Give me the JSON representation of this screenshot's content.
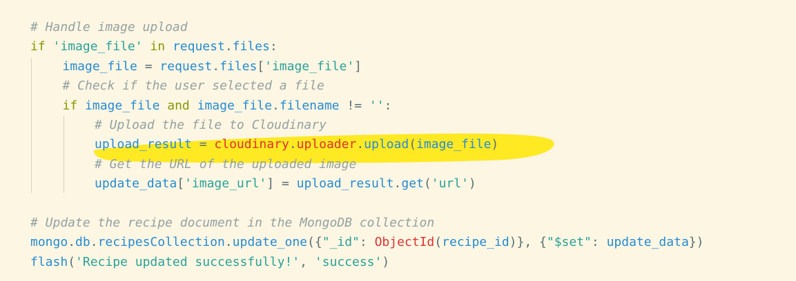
{
  "colors": {
    "background": "#fdf6e3",
    "comment": "#93a1a1",
    "keyword": "#859900",
    "string": "#2aa198",
    "name": "#268bd2",
    "call": "#dc322f",
    "punct": "#586e75",
    "highlight": "#ffe600"
  },
  "lines": [
    {
      "indent": 0,
      "tokens": [
        {
          "t": "# Handle image upload",
          "c": "comment"
        }
      ]
    },
    {
      "indent": 0,
      "tokens": [
        {
          "t": "if",
          "c": "keyword"
        },
        {
          "t": " ",
          "c": "punct"
        },
        {
          "t": "'image_file'",
          "c": "string"
        },
        {
          "t": " ",
          "c": "punct"
        },
        {
          "t": "in",
          "c": "keyword"
        },
        {
          "t": " ",
          "c": "punct"
        },
        {
          "t": "request",
          "c": "name"
        },
        {
          "t": ".",
          "c": "punct"
        },
        {
          "t": "files",
          "c": "name"
        },
        {
          "t": ":",
          "c": "punct"
        }
      ]
    },
    {
      "indent": 1,
      "tokens": [
        {
          "t": "image_file",
          "c": "name"
        },
        {
          "t": " = ",
          "c": "punct"
        },
        {
          "t": "request",
          "c": "name"
        },
        {
          "t": ".",
          "c": "punct"
        },
        {
          "t": "files",
          "c": "name"
        },
        {
          "t": "[",
          "c": "punct"
        },
        {
          "t": "'image_file'",
          "c": "string"
        },
        {
          "t": "]",
          "c": "punct"
        }
      ]
    },
    {
      "indent": 1,
      "tokens": [
        {
          "t": "# Check if the user selected a file",
          "c": "comment"
        }
      ]
    },
    {
      "indent": 1,
      "tokens": [
        {
          "t": "if",
          "c": "keyword"
        },
        {
          "t": " ",
          "c": "punct"
        },
        {
          "t": "image_file",
          "c": "name"
        },
        {
          "t": " ",
          "c": "punct"
        },
        {
          "t": "and",
          "c": "keyword"
        },
        {
          "t": " ",
          "c": "punct"
        },
        {
          "t": "image_file",
          "c": "name"
        },
        {
          "t": ".",
          "c": "punct"
        },
        {
          "t": "filename",
          "c": "name"
        },
        {
          "t": " != ",
          "c": "punct"
        },
        {
          "t": "''",
          "c": "string"
        },
        {
          "t": ":",
          "c": "punct"
        }
      ]
    },
    {
      "indent": 2,
      "tokens": [
        {
          "t": "# Upload the file to Cloudinary",
          "c": "comment"
        }
      ]
    },
    {
      "indent": 2,
      "tokens": [
        {
          "t": "upload_result",
          "c": "name"
        },
        {
          "t": " = ",
          "c": "punct"
        },
        {
          "t": "cloudinary",
          "c": "call"
        },
        {
          "t": ".",
          "c": "punct"
        },
        {
          "t": "uploader",
          "c": "call"
        },
        {
          "t": ".",
          "c": "punct"
        },
        {
          "t": "upload",
          "c": "name"
        },
        {
          "t": "(",
          "c": "punct"
        },
        {
          "t": "image_file",
          "c": "name"
        },
        {
          "t": ")",
          "c": "punct"
        }
      ]
    },
    {
      "indent": 2,
      "tokens": [
        {
          "t": "# Get the URL of the uploaded image",
          "c": "comment"
        }
      ]
    },
    {
      "indent": 2,
      "tokens": [
        {
          "t": "update_data",
          "c": "name"
        },
        {
          "t": "[",
          "c": "punct"
        },
        {
          "t": "'image_url'",
          "c": "string"
        },
        {
          "t": "] = ",
          "c": "punct"
        },
        {
          "t": "upload_result",
          "c": "name"
        },
        {
          "t": ".",
          "c": "punct"
        },
        {
          "t": "get",
          "c": "name"
        },
        {
          "t": "(",
          "c": "punct"
        },
        {
          "t": "'url'",
          "c": "string"
        },
        {
          "t": ")",
          "c": "punct"
        }
      ]
    },
    {
      "indent": 0,
      "tokens": []
    },
    {
      "indent": 0,
      "tokens": [
        {
          "t": "# Update the recipe document in the MongoDB collection",
          "c": "comment"
        }
      ]
    },
    {
      "indent": 0,
      "tokens": [
        {
          "t": "mongo",
          "c": "name"
        },
        {
          "t": ".",
          "c": "punct"
        },
        {
          "t": "db",
          "c": "name"
        },
        {
          "t": ".",
          "c": "punct"
        },
        {
          "t": "recipesCollection",
          "c": "name"
        },
        {
          "t": ".",
          "c": "punct"
        },
        {
          "t": "update_one",
          "c": "name"
        },
        {
          "t": "({",
          "c": "punct"
        },
        {
          "t": "\"_id\"",
          "c": "string"
        },
        {
          "t": ": ",
          "c": "punct"
        },
        {
          "t": "ObjectId",
          "c": "call"
        },
        {
          "t": "(",
          "c": "punct"
        },
        {
          "t": "recipe_id",
          "c": "name"
        },
        {
          "t": ")}, {",
          "c": "punct"
        },
        {
          "t": "\"$set\"",
          "c": "string"
        },
        {
          "t": ": ",
          "c": "punct"
        },
        {
          "t": "update_data",
          "c": "name"
        },
        {
          "t": "})",
          "c": "punct"
        }
      ]
    },
    {
      "indent": 0,
      "tokens": [
        {
          "t": "flash",
          "c": "name"
        },
        {
          "t": "(",
          "c": "punct"
        },
        {
          "t": "'Recipe updated successfully!'",
          "c": "string"
        },
        {
          "t": ", ",
          "c": "punct"
        },
        {
          "t": "'success'",
          "c": "string"
        },
        {
          "t": ")",
          "c": "punct"
        }
      ]
    }
  ]
}
